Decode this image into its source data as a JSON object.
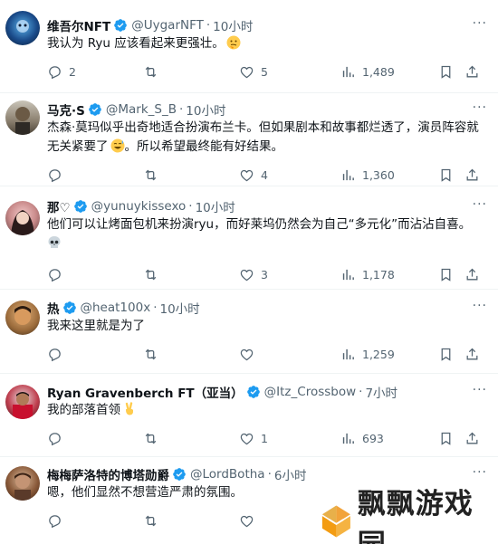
{
  "tweets": [
    {
      "name": "维吾尔NFT",
      "handle": "@UygarNFT",
      "time": "10小时",
      "text": "我认为 Ryu 应该看起来更强壮。",
      "emoji": "thinking-face",
      "replies": "2",
      "retweets": "",
      "likes": "5",
      "views": "1,489"
    },
    {
      "name": "马克·S",
      "handle": "@Mark_S_B",
      "time": "10小时",
      "text": "杰森·莫玛似乎出奇地适合扮演布兰卡。但如果剧本和故事都烂透了，演员阵容就无关紧要了",
      "text_after": "。所以希望最终能有好结果。",
      "emoji": "grinning-sweat-face",
      "replies": "",
      "retweets": "",
      "likes": "4",
      "views": "1,360"
    },
    {
      "name": "那♡",
      "handle": "@yunuykissexo",
      "time": "10小时",
      "text": "他们可以让烤面包机来扮演ryu，而好莱坞仍然会为自己“多元化”而沾沾自喜。",
      "emoji": "skull",
      "replies": "",
      "retweets": "",
      "likes": "3",
      "views": "1,178"
    },
    {
      "name": "热",
      "handle": "@heat100x",
      "time": "10小时",
      "text": "我来这里就是为了",
      "replies": "",
      "retweets": "",
      "likes": "",
      "views": "1,259"
    },
    {
      "name": "Ryan Gravenberch FT（亚当）",
      "handle": "@Itz_Crossbow",
      "time": "7小时",
      "text": "我的部落首领",
      "emoji": "victory-hand",
      "replies": "",
      "retweets": "",
      "likes": "1",
      "views": "693"
    },
    {
      "name": "梅梅萨洛特的博塔勋爵",
      "handle": "@LordBotha",
      "time": "6小时",
      "text": "嗯，他们显然不想营造严肃的氛围。",
      "replies": "",
      "retweets": "",
      "likes": "",
      "views": ""
    }
  ],
  "watermark": {
    "text": "飘飘游戏园"
  },
  "colors": {
    "verified": "#1d9bf0",
    "muted": "#536471",
    "text": "#0f1419",
    "divider": "#eff3f4"
  }
}
